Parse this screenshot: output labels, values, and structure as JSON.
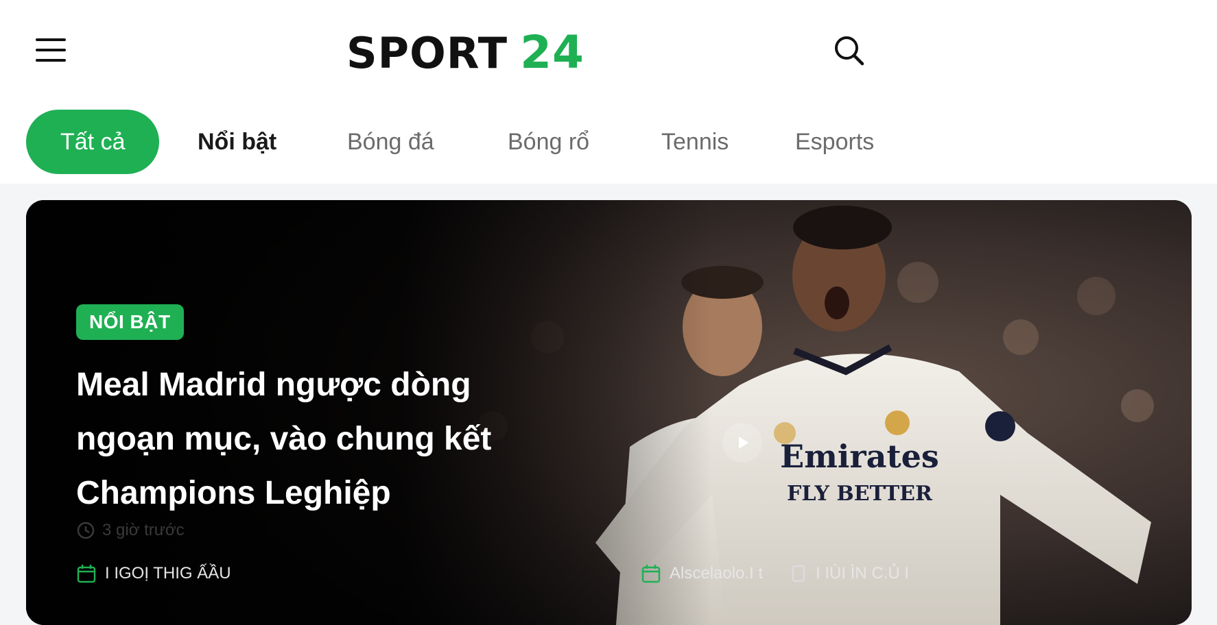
{
  "header": {
    "logo_text": "SPORT",
    "logo_number": "24",
    "menu_icon": "hamburger-menu-icon",
    "search_icon": "search-icon"
  },
  "tabs": [
    {
      "label": "Tất cả",
      "active": true
    },
    {
      "label": "Nổi bật",
      "active": false
    },
    {
      "label": "Bóng đá",
      "active": false
    },
    {
      "label": "Bóng rổ",
      "active": false
    },
    {
      "label": "Tennis",
      "active": false
    },
    {
      "label": "Esports",
      "active": false
    }
  ],
  "hero": {
    "badge": "NỔI BẬT",
    "headline": "Meal Madrid ngược dòng ngoạn mục, vào chung kết Champions Leghiệp",
    "time": "3 giờ trước",
    "meta": [
      {
        "icon": "calendar-icon",
        "label": "I IGOỊ THIG ẤẦU"
      },
      {
        "icon": "calendar-icon",
        "label": "Alscelaolo.I t"
      },
      {
        "icon": "info-icon",
        "label": "I IÙI ÌN C.Ủ I"
      }
    ],
    "play_icon": "play-icon"
  },
  "colors": {
    "brand_green": "#1fb054",
    "text_dark": "#111111",
    "tab_inactive": "#6b6b6b"
  }
}
